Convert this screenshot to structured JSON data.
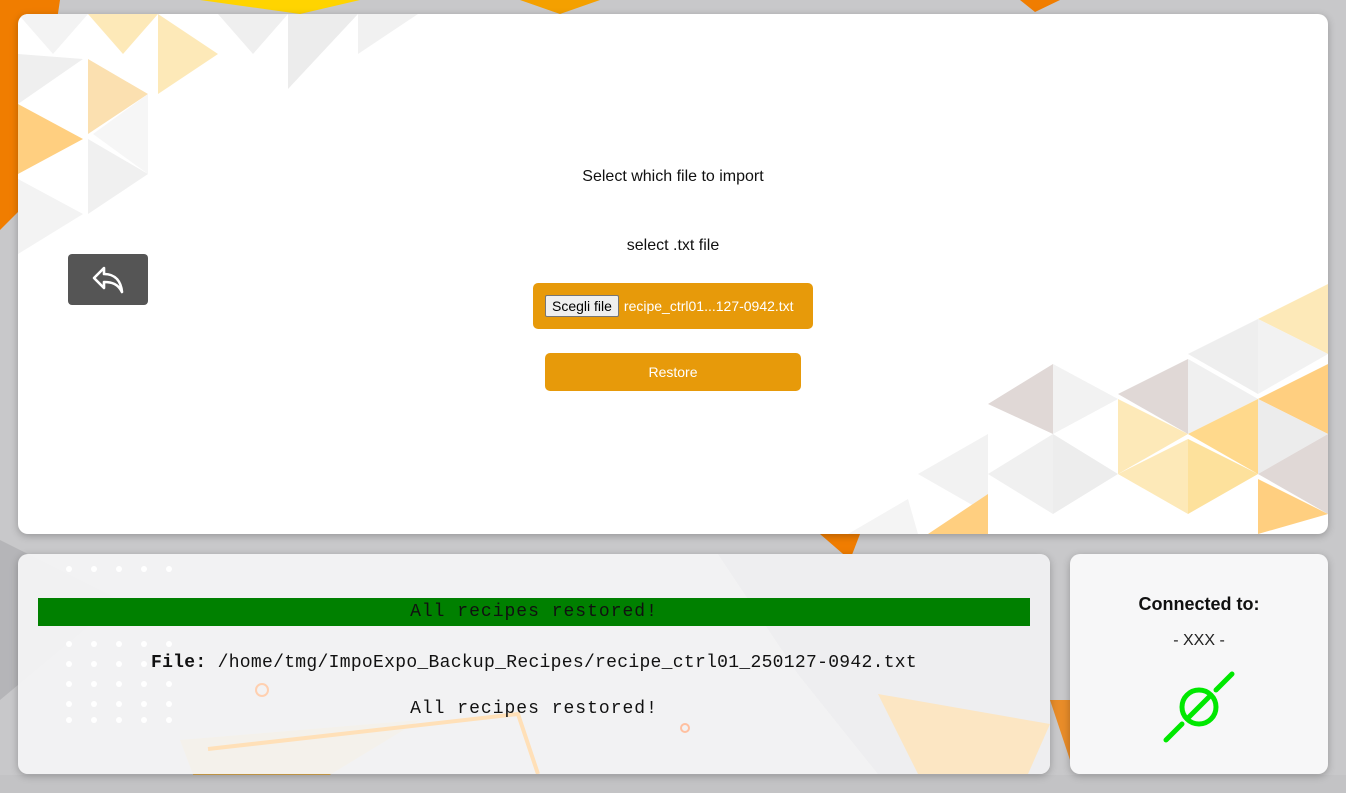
{
  "navigation": {
    "back_icon": "reply-arrow-icon"
  },
  "import": {
    "title": "Select which file to import",
    "hint": "select .txt file",
    "choose_file_label": "Scegli file",
    "selected_file": "recipe_ctrl01...127-0942.txt",
    "restore_label": "Restore"
  },
  "log": {
    "status_banner": "All recipes restored!",
    "file_label": "File:",
    "file_path": "/home/tmg/ImpoExpo_Backup_Recipes/recipe_ctrl01_250127-0942.txt",
    "result": "All recipes restored!"
  },
  "connection": {
    "title": "Connected to:",
    "host": "- XXX -",
    "status_icon": "plug-connected-icon",
    "status_color": "#00e800"
  },
  "colors": {
    "accent": "#e79a0a",
    "success": "#008000",
    "back_button": "#555555"
  }
}
